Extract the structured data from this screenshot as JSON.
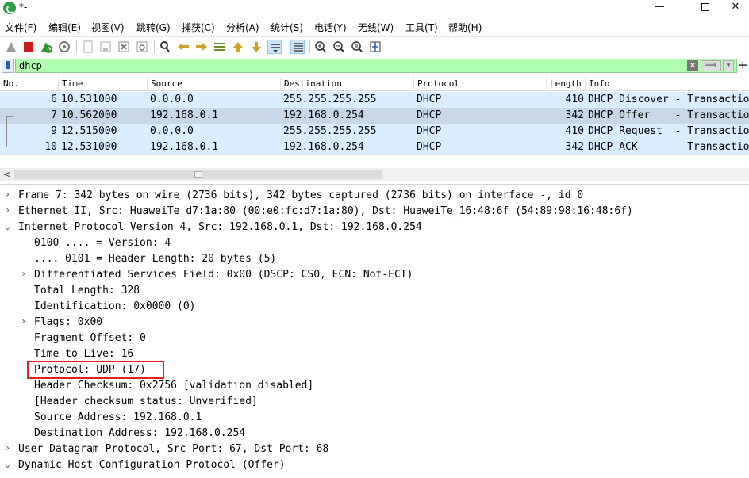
{
  "window": {
    "title": "*-",
    "controls": {
      "minimize": "—",
      "maximize": "",
      "close": "✕"
    }
  },
  "menu": [
    "文件(F)",
    "编辑(E)",
    "视图(V)",
    "跳转(G)",
    "捕获(C)",
    "分析(A)",
    "统计(S)",
    "电话(Y)",
    "无线(W)",
    "工具(T)",
    "帮助(H)"
  ],
  "filter": {
    "value": "dhcp",
    "clear": "✕",
    "apply": "⟹",
    "dropdown": "▾",
    "add": "+"
  },
  "packet_list": {
    "columns": [
      "No.",
      "Time",
      "Source",
      "Destination",
      "Protocol",
      "Length",
      "Info"
    ],
    "rows": [
      {
        "no": "6",
        "time": "10.531000",
        "src": "0.0.0.0",
        "dst": "255.255.255.255",
        "proto": "DHCP",
        "len": "410",
        "info": "DHCP Discover - Transaction"
      },
      {
        "no": "7",
        "time": "10.562000",
        "src": "192.168.0.1",
        "dst": "192.168.0.254",
        "proto": "DHCP",
        "len": "342",
        "info": "DHCP Offer    - Transaction"
      },
      {
        "no": "9",
        "time": "12.515000",
        "src": "0.0.0.0",
        "dst": "255.255.255.255",
        "proto": "DHCP",
        "len": "410",
        "info": "DHCP Request  - Transaction"
      },
      {
        "no": "10",
        "time": "12.531000",
        "src": "192.168.0.1",
        "dst": "192.168.0.254",
        "proto": "DHCP",
        "len": "342",
        "info": "DHCP ACK      - Transaction"
      }
    ],
    "selected_row": 2
  },
  "details": [
    {
      "arrow": "›",
      "text": "Frame 7: 342 bytes on wire (2736 bits), 342 bytes captured (2736 bits) on interface -, id 0"
    },
    {
      "arrow": "›",
      "text": "Ethernet II, Src: HuaweiTe_d7:1a:80 (00:e0:fc:d7:1a:80), Dst: HuaweiTe_16:48:6f (54:89:98:16:48:6f)"
    },
    {
      "arrow": "⌄",
      "text": "Internet Protocol Version 4, Src: 192.168.0.1, Dst: 192.168.0.254"
    },
    {
      "arrow": "",
      "text": "0100 .... = Version: 4"
    },
    {
      "arrow": "",
      "text": ".... 0101 = Header Length: 20 bytes (5)"
    },
    {
      "arrow": "›",
      "text": "Differentiated Services Field: 0x00 (DSCP: CS0, ECN: Not-ECT)"
    },
    {
      "arrow": "",
      "text": "Total Length: 328"
    },
    {
      "arrow": "",
      "text": "Identification: 0x0000 (0)"
    },
    {
      "arrow": "›",
      "text": "Flags: 0x00"
    },
    {
      "arrow": "",
      "text": "Fragment Offset: 0"
    },
    {
      "arrow": "",
      "text": "Time to Live: 16"
    },
    {
      "arrow": "",
      "text": "Protocol: UDP (17)"
    },
    {
      "arrow": "",
      "text": "Header Checksum: 0x2756 [validation disabled]"
    },
    {
      "arrow": "",
      "text": "[Header checksum status: Unverified]"
    },
    {
      "arrow": "",
      "text": "Source Address: 192.168.0.1"
    },
    {
      "arrow": "",
      "text": "Destination Address: 192.168.0.254"
    },
    {
      "arrow": "›",
      "text": "User Datagram Protocol, Src Port: 67, Dst Port: 68"
    },
    {
      "arrow": "⌄",
      "text": "Dynamic Host Configuration Protocol (Offer)"
    }
  ],
  "hscroll": {
    "left_arrow": "<"
  },
  "colors": {
    "filter_bg": "#afffaf",
    "row_bg": "#daeeff",
    "selected_row_bg": "#c7d7e8",
    "highlight": "#e02020"
  }
}
